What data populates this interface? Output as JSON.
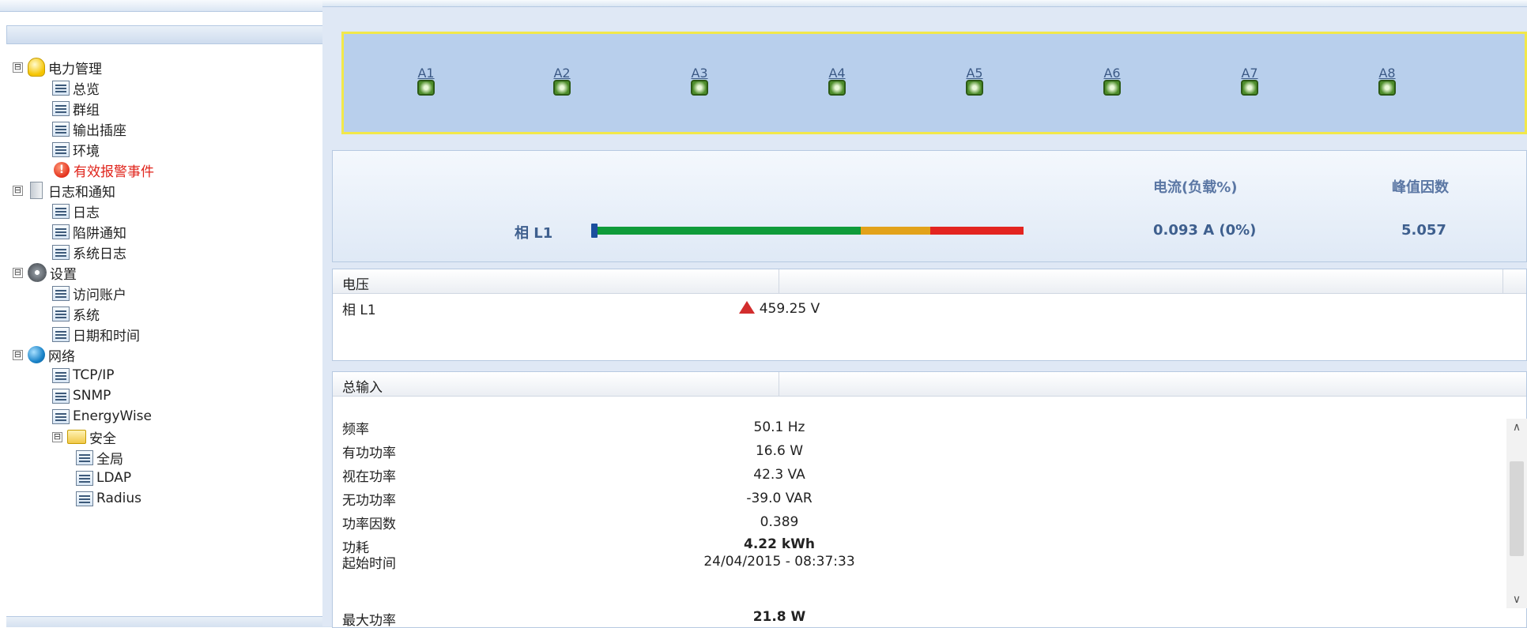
{
  "tree": {
    "items": [
      {
        "label": "电力管理",
        "icon": "bulb-icon",
        "expander": "⊟"
      },
      {
        "label": "总览",
        "icon": "page-icon"
      },
      {
        "label": "群组",
        "icon": "page-icon"
      },
      {
        "label": "输出插座",
        "icon": "page-icon"
      },
      {
        "label": "环境",
        "icon": "page-icon"
      },
      {
        "label": "有效报警事件",
        "icon": "alert-icon"
      },
      {
        "label": "日志和通知",
        "icon": "document-icon",
        "expander": "⊟"
      },
      {
        "label": "日志",
        "icon": "page-icon"
      },
      {
        "label": "陷阱通知",
        "icon": "page-icon"
      },
      {
        "label": "系统日志",
        "icon": "page-icon"
      },
      {
        "label": "设置",
        "icon": "gear-icon",
        "expander": "⊟"
      },
      {
        "label": "访问账户",
        "icon": "page-icon"
      },
      {
        "label": "系统",
        "icon": "page-icon"
      },
      {
        "label": "日期和时间",
        "icon": "page-icon"
      },
      {
        "label": "网络",
        "icon": "globe-icon",
        "expander": "⊟"
      },
      {
        "label": "TCP/IP",
        "icon": "page-icon"
      },
      {
        "label": "SNMP",
        "icon": "page-icon"
      },
      {
        "label": "EnergyWise",
        "icon": "page-icon"
      },
      {
        "label": "安全",
        "icon": "folder-icon",
        "expander": "⊟"
      },
      {
        "label": "全局",
        "icon": "page-icon"
      },
      {
        "label": "LDAP",
        "icon": "page-icon"
      },
      {
        "label": "Radius",
        "icon": "page-icon"
      }
    ]
  },
  "outlets": [
    "A1",
    "A2",
    "A3",
    "A4",
    "A5",
    "A6",
    "A7",
    "A8"
  ],
  "phase": {
    "header_current": "电流(负载%)",
    "header_crest": "峰值因数",
    "label": "相 L1",
    "current": "0.093 A (0%)",
    "crest": "5.057",
    "load_fraction": 0.0
  },
  "voltage": {
    "title": "电压",
    "row_label": "相 L1",
    "value": "459.25 V"
  },
  "total_input": {
    "title": "总输入",
    "rows": [
      {
        "label": "频率",
        "value": "50.1 Hz"
      },
      {
        "label": "有功功率",
        "value": "16.6 W"
      },
      {
        "label": "视在功率",
        "value": "42.3 VA"
      },
      {
        "label": "无功功率",
        "value": "-39.0 VAR"
      },
      {
        "label": "功率因数",
        "value": "0.389"
      },
      {
        "label": "功耗",
        "value": "4.22 kWh"
      },
      {
        "label": "起始时间",
        "value": "24/04/2015 - 08:37:33"
      },
      {
        "label": "最大功率",
        "value": "21.8 W"
      }
    ]
  },
  "colors": {
    "alert_text": "#e0241b",
    "header_blue": "#5b77a4",
    "bar_green": "#0f9b3a",
    "bar_yellow": "#e2a21a",
    "bar_red": "#e32420"
  }
}
